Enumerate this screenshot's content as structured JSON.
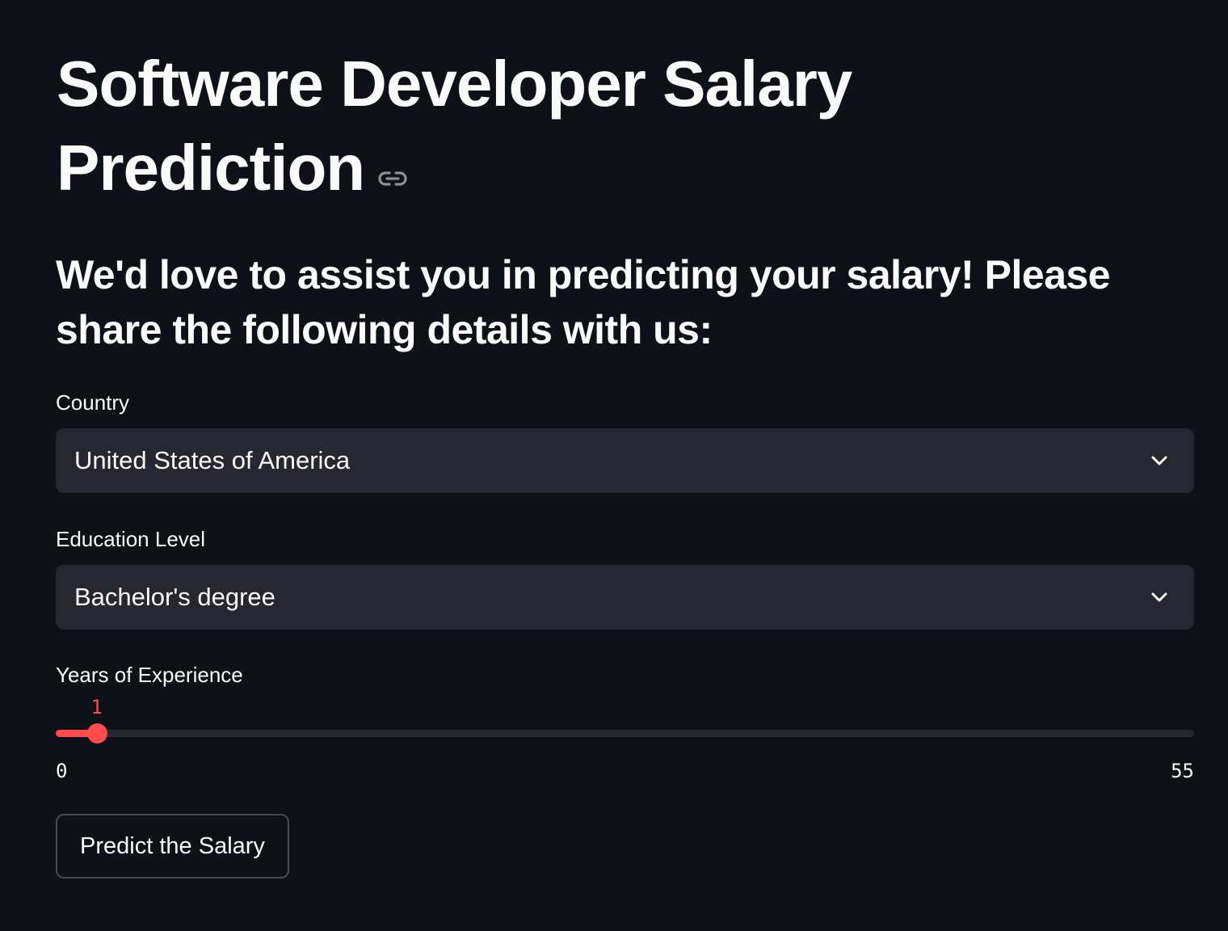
{
  "header": {
    "title": "Software Developer Salary Prediction",
    "anchor_icon": "link-icon"
  },
  "intro": {
    "text": "We'd love to assist you in predicting your salary! Please share the following details with us:"
  },
  "form": {
    "country": {
      "label": "Country",
      "value": "United States of America",
      "icon": "chevron-down-icon"
    },
    "education": {
      "label": "Education Level",
      "value": "Bachelor's degree",
      "icon": "chevron-down-icon"
    },
    "experience": {
      "label": "Years of Experience",
      "value": 1,
      "min": 0,
      "max": 55,
      "value_text": "1",
      "min_text": "0",
      "max_text": "55"
    },
    "submit_label": "Predict the Salary"
  },
  "colors": {
    "background": "#0e1117",
    "input_background": "#262730",
    "accent": "#ff4b4b",
    "text": "#fafafa"
  }
}
